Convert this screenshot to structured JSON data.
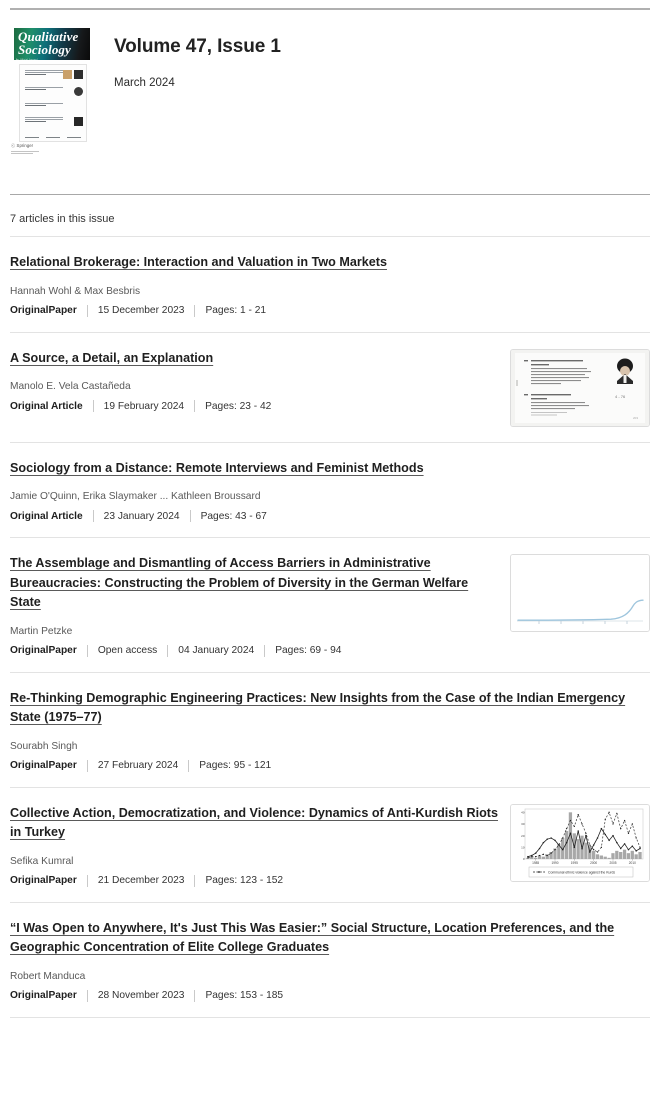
{
  "header": {
    "cover": {
      "journal_line1": "Qualitative",
      "journal_line2": "Sociology",
      "journal_subtitle": "An Official Journal",
      "publisher": "ⓒ Springer"
    },
    "title": "Volume 47, Issue 1",
    "date": "March 2024"
  },
  "list": {
    "count_label": "7 articles in this issue"
  },
  "articles": [
    {
      "title": "Relational Brokerage: Interaction and Valuation in Two Markets",
      "authors": "Hannah Wohl & Max Besbris",
      "type": "OriginalPaper",
      "access": "",
      "date": "15 December 2023",
      "pages": "Pages: 1 - 21",
      "thumbnail": "none"
    },
    {
      "title": "A Source, a Detail, an Explanation",
      "authors": "Manolo E. Vela Castañeda",
      "type": "Original Article",
      "access": "",
      "date": "19 February 2024",
      "pages": "Pages: 23 - 42",
      "thumbnail": "scanned-document"
    },
    {
      "title": "Sociology from a Distance: Remote Interviews and Feminist Methods",
      "authors": "Jamie O'Quinn, Erika Slaymaker ... Kathleen Broussard",
      "type": "Original Article",
      "access": "",
      "date": "23 January 2024",
      "pages": "Pages: 43 - 67",
      "thumbnail": "none"
    },
    {
      "title": "The Assemblage and Dismantling of Access Barriers in Administrative Bureaucracies: Constructing the Problem of Diversity in the German Welfare State",
      "authors": "Martin Petzke",
      "type": "OriginalPaper",
      "access": "Open access",
      "date": "04 January 2024",
      "pages": "Pages: 69 - 94",
      "thumbnail": "line-chart"
    },
    {
      "title": "Re-Thinking Demographic Engineering Practices: New Insights from the Case of the Indian Emergency State (1975–77)",
      "authors": "Sourabh Singh",
      "type": "OriginalPaper",
      "access": "",
      "date": "27 February 2024",
      "pages": "Pages: 95 - 121",
      "thumbnail": "none"
    },
    {
      "title": "Collective Action, Democratization, and Violence: Dynamics of Anti-Kurdish Riots in Turkey",
      "authors": "Sefika Kumral",
      "type": "OriginalPaper",
      "access": "",
      "date": "21 December 2023",
      "pages": "Pages: 123 - 152",
      "thumbnail": "bar-line-chart"
    },
    {
      "title": "“I Was Open to Anywhere, It's Just This Was Easier:” Social Structure, Location Preferences, and the Geographic Concentration of Elite College Graduates",
      "authors": "Robert Manduca",
      "type": "OriginalPaper",
      "access": "",
      "date": "28 November 2023",
      "pages": "Pages: 153 - 185",
      "thumbnail": "none"
    }
  ],
  "thumbnails": {
    "line_chart": {
      "type": "line",
      "line_color": "#9ec5dd",
      "axis_color": "#cfd8de",
      "tick_count": 5,
      "description": "flat baseline curve rising steeply near right edge"
    },
    "bar_line_chart": {
      "type": "bar",
      "legend": "Communal ethnic violence against the Kurds",
      "xticks": [
        "1985",
        "1990",
        "1995",
        "2000",
        "2005",
        "2010"
      ],
      "yticks": [
        "0",
        "10",
        "20",
        "30",
        "40"
      ],
      "bar_color": "#a8a8a8",
      "line_color": "#222222",
      "bars": [
        1,
        2,
        1,
        3,
        2,
        4,
        6,
        9,
        13,
        18,
        24,
        40,
        22,
        17,
        20,
        14,
        11,
        7,
        4,
        3,
        2,
        1,
        5,
        7,
        6,
        8,
        5,
        7,
        4,
        6
      ],
      "solid_line": [
        2,
        3,
        5,
        9,
        14,
        17,
        18,
        16,
        12,
        8,
        14,
        22,
        10,
        24,
        9,
        20,
        6,
        12,
        18,
        26,
        21,
        16,
        20,
        14,
        9,
        13,
        8,
        11,
        7,
        9
      ],
      "dashed_line": [
        1,
        2,
        2,
        3,
        4,
        3,
        5,
        8,
        12,
        18,
        26,
        33,
        28,
        38,
        30,
        22,
        12,
        8,
        6,
        10,
        34,
        40,
        30,
        39,
        26,
        33,
        22,
        30,
        18,
        10
      ]
    }
  }
}
